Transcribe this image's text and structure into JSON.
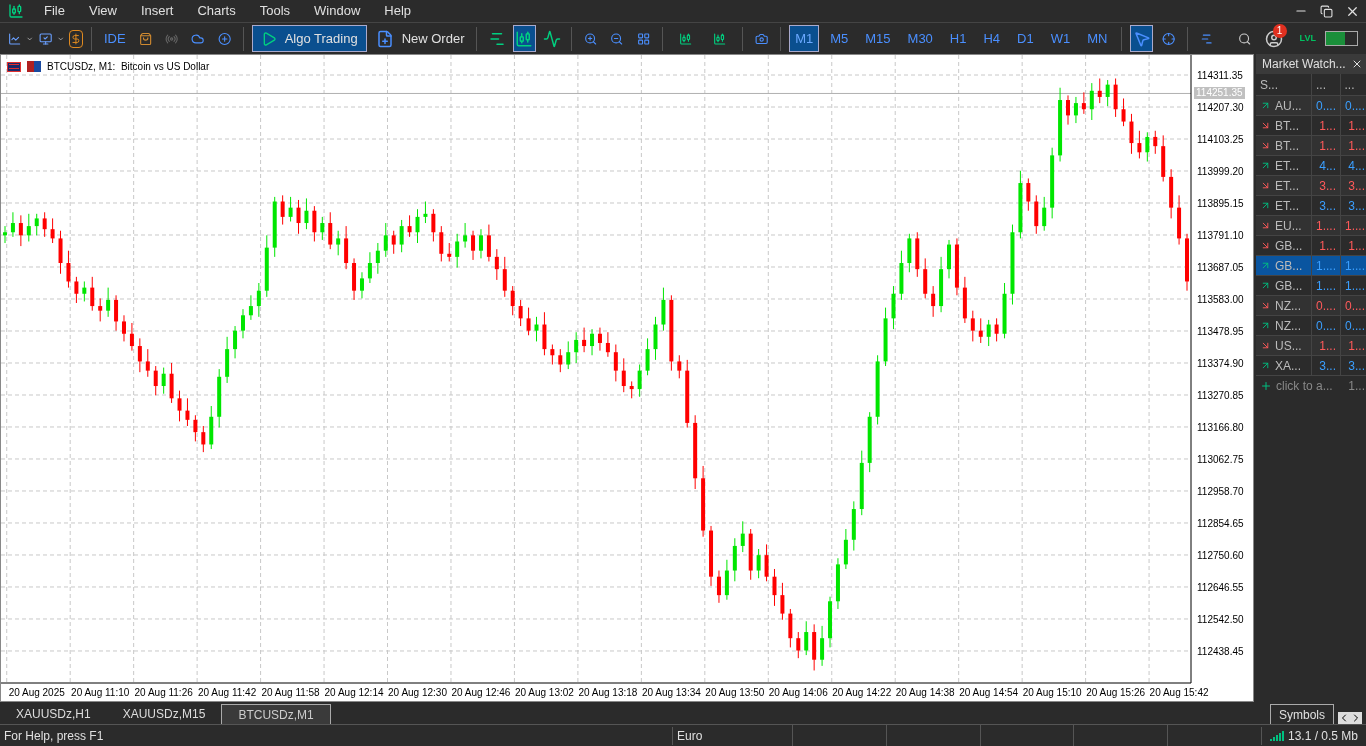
{
  "menu": [
    "File",
    "View",
    "Insert",
    "Charts",
    "Tools",
    "Window",
    "Help"
  ],
  "toolbar": {
    "ide": "IDE",
    "algo_trading": {
      "label": "Algo Trading",
      "on": true
    },
    "new_order": "New Order",
    "chart_modes": [
      {
        "selected": false
      },
      {
        "selected": true
      },
      {
        "selected": false
      }
    ],
    "timeframes": [
      {
        "label": "M1",
        "selected": true
      },
      {
        "label": "M5",
        "selected": false
      },
      {
        "label": "M15",
        "selected": false
      },
      {
        "label": "M30",
        "selected": false
      },
      {
        "label": "H1",
        "selected": false
      },
      {
        "label": "H4",
        "selected": false
      },
      {
        "label": "D1",
        "selected": false
      },
      {
        "label": "W1",
        "selected": false
      },
      {
        "label": "MN",
        "selected": false
      }
    ],
    "cursor_selected": true,
    "notification_count": "1",
    "lvl": "LVL"
  },
  "chart": {
    "chart_data": {
      "type": "candlestick",
      "title": "BTCUSDz, M1:  Bitcoin vs US Dollar",
      "ylim": [
        112334.3,
        114376.4
      ],
      "grid": true,
      "ref_lines": [
        {
          "axis": "y",
          "value": 114251.35,
          "label": "114251.35"
        }
      ],
      "categories": [
        null,
        null,
        null,
        null,
        "20 Aug 2025",
        null,
        null,
        null,
        null,
        null,
        null,
        null,
        "20 Aug 11:10",
        null,
        null,
        null,
        null,
        null,
        null,
        null,
        "20 Aug 11:26",
        null,
        null,
        null,
        null,
        null,
        null,
        null,
        "20 Aug 11:42",
        null,
        null,
        null,
        null,
        null,
        null,
        null,
        "20 Aug 11:58",
        null,
        null,
        null,
        null,
        null,
        null,
        null,
        "20 Aug 12:14",
        null,
        null,
        null,
        null,
        null,
        null,
        null,
        "20 Aug 12:30",
        null,
        null,
        null,
        null,
        null,
        null,
        null,
        "20 Aug 12:46",
        null,
        null,
        null,
        null,
        null,
        null,
        null,
        "20 Aug 13:02",
        null,
        null,
        null,
        null,
        null,
        null,
        null,
        "20 Aug 13:18",
        null,
        null,
        null,
        null,
        null,
        null,
        null,
        "20 Aug 13:34",
        null,
        null,
        null,
        null,
        null,
        null,
        null,
        "20 Aug 13:50",
        null,
        null,
        null,
        null,
        null,
        null,
        null,
        "20 Aug 14:06",
        null,
        null,
        null,
        null,
        null,
        null,
        null,
        "20 Aug 14:22",
        null,
        null,
        null,
        null,
        null,
        null,
        null,
        "20 Aug 14:38",
        null,
        null,
        null,
        null,
        null,
        null,
        null,
        "20 Aug 14:54",
        null,
        null,
        null,
        null,
        null,
        null,
        null,
        "20 Aug 15:10",
        null,
        null,
        null,
        null,
        null,
        null,
        null,
        "20 Aug 15:26",
        null,
        null,
        null,
        null,
        null,
        null,
        null,
        "20 Aug 15:42",
        null
      ],
      "ohlc": [
        [
          113790,
          113820,
          113765,
          113800
        ],
        [
          113800,
          113865,
          113785,
          113830
        ],
        [
          113830,
          113855,
          113755,
          113790
        ],
        [
          113790,
          113860,
          113770,
          113820
        ],
        [
          113820,
          113860,
          113790,
          113845
        ],
        [
          113845,
          113865,
          113785,
          113810
        ],
        [
          113810,
          113845,
          113765,
          113780
        ],
        [
          113780,
          113805,
          113665,
          113700
        ],
        [
          113700,
          113740,
          113620,
          113640
        ],
        [
          113640,
          113655,
          113570,
          113600
        ],
        [
          113600,
          113640,
          113575,
          113620
        ],
        [
          113620,
          113655,
          113545,
          113560
        ],
        [
          113560,
          113585,
          113510,
          113545
        ],
        [
          113545,
          113620,
          113525,
          113580
        ],
        [
          113580,
          113595,
          113480,
          113510
        ],
        [
          113510,
          113530,
          113445,
          113470
        ],
        [
          113470,
          113505,
          113415,
          113430
        ],
        [
          113430,
          113455,
          113345,
          113380
        ],
        [
          113380,
          113420,
          113330,
          113350
        ],
        [
          113350,
          113365,
          113270,
          113300
        ],
        [
          113300,
          113360,
          113275,
          113340
        ],
        [
          113340,
          113375,
          113245,
          113260
        ],
        [
          113260,
          113285,
          113185,
          113220
        ],
        [
          113220,
          113260,
          113170,
          113190
        ],
        [
          113190,
          113205,
          113120,
          113150
        ],
        [
          113150,
          113170,
          113085,
          113110
        ],
        [
          113110,
          113235,
          113095,
          113200
        ],
        [
          113200,
          113355,
          113165,
          113330
        ],
        [
          113330,
          113460,
          113310,
          113420
        ],
        [
          113420,
          113495,
          113390,
          113480
        ],
        [
          113480,
          113550,
          113455,
          113530
        ],
        [
          113530,
          113595,
          113515,
          113560
        ],
        [
          113560,
          113635,
          113525,
          113610
        ],
        [
          113610,
          113790,
          113590,
          113750
        ],
        [
          113750,
          113915,
          113720,
          113900
        ],
        [
          113900,
          113920,
          113825,
          113850
        ],
        [
          113850,
          113915,
          113835,
          113880
        ],
        [
          113880,
          113905,
          113795,
          113830
        ],
        [
          113830,
          113910,
          113810,
          113870
        ],
        [
          113870,
          113885,
          113770,
          113800
        ],
        [
          113800,
          113850,
          113775,
          113830
        ],
        [
          113830,
          113865,
          113745,
          113760
        ],
        [
          113760,
          113805,
          113725,
          113780
        ],
        [
          113780,
          113820,
          113680,
          113700
        ],
        [
          113700,
          113715,
          113580,
          113610
        ],
        [
          113610,
          113670,
          113585,
          113650
        ],
        [
          113650,
          113735,
          113635,
          113700
        ],
        [
          113700,
          113765,
          113665,
          113740
        ],
        [
          113740,
          113830,
          113720,
          113790
        ],
        [
          113790,
          113805,
          113730,
          113760
        ],
        [
          113760,
          113840,
          113735,
          113820
        ],
        [
          113820,
          113855,
          113785,
          113800
        ],
        [
          113800,
          113875,
          113765,
          113850
        ],
        [
          113850,
          113900,
          113830,
          113860
        ],
        [
          113860,
          113875,
          113770,
          113800
        ],
        [
          113800,
          113820,
          113705,
          113730
        ],
        [
          113730,
          113765,
          113705,
          113720
        ],
        [
          113720,
          113795,
          113685,
          113770
        ],
        [
          113770,
          113830,
          113750,
          113790
        ],
        [
          113790,
          113805,
          113710,
          113740
        ],
        [
          113740,
          113810,
          113715,
          113790
        ],
        [
          113790,
          113825,
          113705,
          113720
        ],
        [
          113720,
          113745,
          113645,
          113680
        ],
        [
          113680,
          113720,
          113590,
          113610
        ],
        [
          113610,
          113625,
          113530,
          113560
        ],
        [
          113560,
          113580,
          113495,
          113520
        ],
        [
          113520,
          113555,
          113465,
          113480
        ],
        [
          113480,
          113525,
          113445,
          113500
        ],
        [
          113500,
          113540,
          113400,
          113420
        ],
        [
          113420,
          113435,
          113370,
          113400
        ],
        [
          113400,
          113420,
          113345,
          113370
        ],
        [
          113370,
          113445,
          113355,
          113410
        ],
        [
          113410,
          113475,
          113375,
          113450
        ],
        [
          113450,
          113490,
          113410,
          113430
        ],
        [
          113430,
          113485,
          113400,
          113470
        ],
        [
          113470,
          113490,
          113415,
          113440
        ],
        [
          113440,
          113475,
          113395,
          113410
        ],
        [
          113410,
          113435,
          113315,
          113350
        ],
        [
          113350,
          113390,
          113280,
          113300
        ],
        [
          113300,
          113315,
          113260,
          113290
        ],
        [
          113290,
          113370,
          113265,
          113350
        ],
        [
          113350,
          113455,
          113335,
          113420
        ],
        [
          113420,
          113525,
          113385,
          113500
        ],
        [
          113500,
          113620,
          113480,
          113580
        ],
        [
          113580,
          113595,
          113350,
          113380
        ],
        [
          113380,
          113400,
          113325,
          113350
        ],
        [
          113350,
          113385,
          113165,
          113180
        ],
        [
          113180,
          113205,
          112965,
          113000
        ],
        [
          113000,
          113040,
          112810,
          112830
        ],
        [
          112830,
          112845,
          112650,
          112680
        ],
        [
          112680,
          112700,
          112595,
          112620
        ],
        [
          112620,
          112735,
          112605,
          112700
        ],
        [
          112700,
          112805,
          112665,
          112780
        ],
        [
          112780,
          112860,
          112760,
          112820
        ],
        [
          112820,
          112835,
          112670,
          112700
        ],
        [
          112700,
          112770,
          112675,
          112750
        ],
        [
          112750,
          112785,
          112665,
          112680
        ],
        [
          112680,
          112705,
          112585,
          112620
        ],
        [
          112620,
          112660,
          112540,
          112560
        ],
        [
          112560,
          112575,
          112450,
          112480
        ],
        [
          112480,
          112500,
          112415,
          112440
        ],
        [
          112440,
          112535,
          112425,
          112500
        ],
        [
          112500,
          112525,
          112375,
          112410
        ],
        [
          112410,
          112520,
          112390,
          112480
        ],
        [
          112480,
          112615,
          112450,
          112600
        ],
        [
          112600,
          112740,
          112575,
          112720
        ],
        [
          112720,
          112835,
          112705,
          112800
        ],
        [
          112800,
          112925,
          112765,
          112900
        ],
        [
          112900,
          113090,
          112880,
          113050
        ],
        [
          113050,
          113215,
          113020,
          113200
        ],
        [
          113200,
          113400,
          113175,
          113380
        ],
        [
          113380,
          113555,
          113365,
          113520
        ],
        [
          113520,
          113625,
          113485,
          113600
        ],
        [
          113600,
          113740,
          113580,
          113700
        ],
        [
          113700,
          113795,
          113670,
          113780
        ],
        [
          113780,
          113800,
          113655,
          113680
        ],
        [
          113680,
          113715,
          113585,
          113600
        ],
        [
          113600,
          113625,
          113525,
          113560
        ],
        [
          113560,
          113720,
          113540,
          113680
        ],
        [
          113680,
          113775,
          113650,
          113760
        ],
        [
          113760,
          113780,
          113595,
          113620
        ],
        [
          113620,
          113655,
          113505,
          113520
        ],
        [
          113520,
          113545,
          113445,
          113480
        ],
        [
          113480,
          113520,
          113440,
          113460
        ],
        [
          113460,
          113515,
          113430,
          113500
        ],
        [
          113500,
          113520,
          113445,
          113470
        ],
        [
          113470,
          113635,
          113455,
          113600
        ],
        [
          113600,
          113825,
          113565,
          113800
        ],
        [
          113800,
          114000,
          113780,
          113960
        ],
        [
          113960,
          113975,
          113870,
          113900
        ],
        [
          113900,
          113920,
          113795,
          113820
        ],
        [
          113820,
          113915,
          113805,
          113880
        ],
        [
          113880,
          114075,
          113845,
          114050
        ],
        [
          114050,
          114270,
          114030,
          114230
        ],
        [
          114230,
          114245,
          114150,
          114180
        ],
        [
          114180,
          114240,
          114155,
          114220
        ],
        [
          114220,
          114255,
          114185,
          114200
        ],
        [
          114200,
          114285,
          114165,
          114260
        ],
        [
          114260,
          114300,
          114220,
          114240
        ],
        [
          114240,
          114295,
          114210,
          114280
        ],
        [
          114280,
          114300,
          114175,
          114200
        ],
        [
          114200,
          114235,
          114145,
          114160
        ],
        [
          114160,
          114185,
          114055,
          114090
        ],
        [
          114090,
          114130,
          114040,
          114060
        ],
        [
          114060,
          114125,
          114030,
          114110
        ],
        [
          114110,
          114130,
          114055,
          114080
        ],
        [
          114080,
          114115,
          113965,
          113980
        ],
        [
          113980,
          114005,
          113845,
          113880
        ],
        [
          113880,
          113920,
          113760,
          113780
        ],
        [
          113780,
          113795,
          113610,
          113640
        ]
      ],
      "yticks": [
        {
          "value": 114311.35,
          "label": "114311.35"
        },
        {
          "value": 114207.3,
          "label": "114207.30"
        },
        {
          "value": 114103.25,
          "label": "114103.25"
        },
        {
          "value": 113999.2,
          "label": "113999.20"
        },
        {
          "value": 113895.15,
          "label": "113895.15"
        },
        {
          "value": 113791.1,
          "label": "113791.10"
        },
        {
          "value": 113687.05,
          "label": "113687.05"
        },
        {
          "value": 113583.0,
          "label": "113583.00"
        },
        {
          "value": 113478.95,
          "label": "113478.95"
        },
        {
          "value": 113374.9,
          "label": "113374.90"
        },
        {
          "value": 113270.85,
          "label": "113270.85"
        },
        {
          "value": 113166.8,
          "label": "113166.80"
        },
        {
          "value": 113062.75,
          "label": "113062.75"
        },
        {
          "value": 112958.7,
          "label": "112958.70"
        },
        {
          "value": 112854.65,
          "label": "112854.65"
        },
        {
          "value": 112750.6,
          "label": "112750.60"
        },
        {
          "value": 112646.55,
          "label": "112646.55"
        },
        {
          "value": 112542.5,
          "label": "112542.50"
        },
        {
          "value": 112438.45,
          "label": "112438.45"
        }
      ]
    }
  },
  "market_watch": {
    "title": "Market Watch...",
    "columns": [
      "S...",
      "...",
      "..."
    ],
    "rows": [
      {
        "symbol": "AU...",
        "bid": "0....",
        "ask": "0....",
        "rising": true,
        "selected": false
      },
      {
        "symbol": "BT...",
        "bid": "1...",
        "ask": "1...",
        "rising": false,
        "selected": false
      },
      {
        "symbol": "BT...",
        "bid": "1...",
        "ask": "1...",
        "rising": false,
        "selected": false
      },
      {
        "symbol": "ET...",
        "bid": "4...",
        "ask": "4...",
        "rising": true,
        "selected": false
      },
      {
        "symbol": "ET...",
        "bid": "3...",
        "ask": "3...",
        "rising": false,
        "selected": false
      },
      {
        "symbol": "ET...",
        "bid": "3...",
        "ask": "3...",
        "rising": true,
        "selected": false
      },
      {
        "symbol": "EU...",
        "bid": "1....",
        "ask": "1....",
        "rising": false,
        "selected": false
      },
      {
        "symbol": "GB...",
        "bid": "1...",
        "ask": "1...",
        "rising": false,
        "selected": false
      },
      {
        "symbol": "GB...",
        "bid": "1....",
        "ask": "1....",
        "rising": true,
        "selected": true
      },
      {
        "symbol": "GB...",
        "bid": "1....",
        "ask": "1....",
        "rising": true,
        "selected": false
      },
      {
        "symbol": "NZ...",
        "bid": "0....",
        "ask": "0....",
        "rising": false,
        "selected": false
      },
      {
        "symbol": "NZ...",
        "bid": "0....",
        "ask": "0....",
        "rising": true,
        "selected": false
      },
      {
        "symbol": "US...",
        "bid": "1...",
        "ask": "1...",
        "rising": false,
        "selected": false
      },
      {
        "symbol": "XA...",
        "bid": "3...",
        "ask": "3...",
        "rising": true,
        "selected": false
      }
    ],
    "add_row": {
      "label": "click to a...",
      "value": "1..."
    },
    "tab": "Symbols"
  },
  "chart_tabs": [
    {
      "label": "XAUUSDz,H1",
      "selected": false
    },
    {
      "label": "XAUUSDz,M15",
      "selected": false
    },
    {
      "label": "BTCUSDz,M1",
      "selected": true
    }
  ],
  "status_bar": {
    "help": "For Help, press F1",
    "profile": "Euro",
    "traffic": "13.1 / 0.5 Mb"
  }
}
